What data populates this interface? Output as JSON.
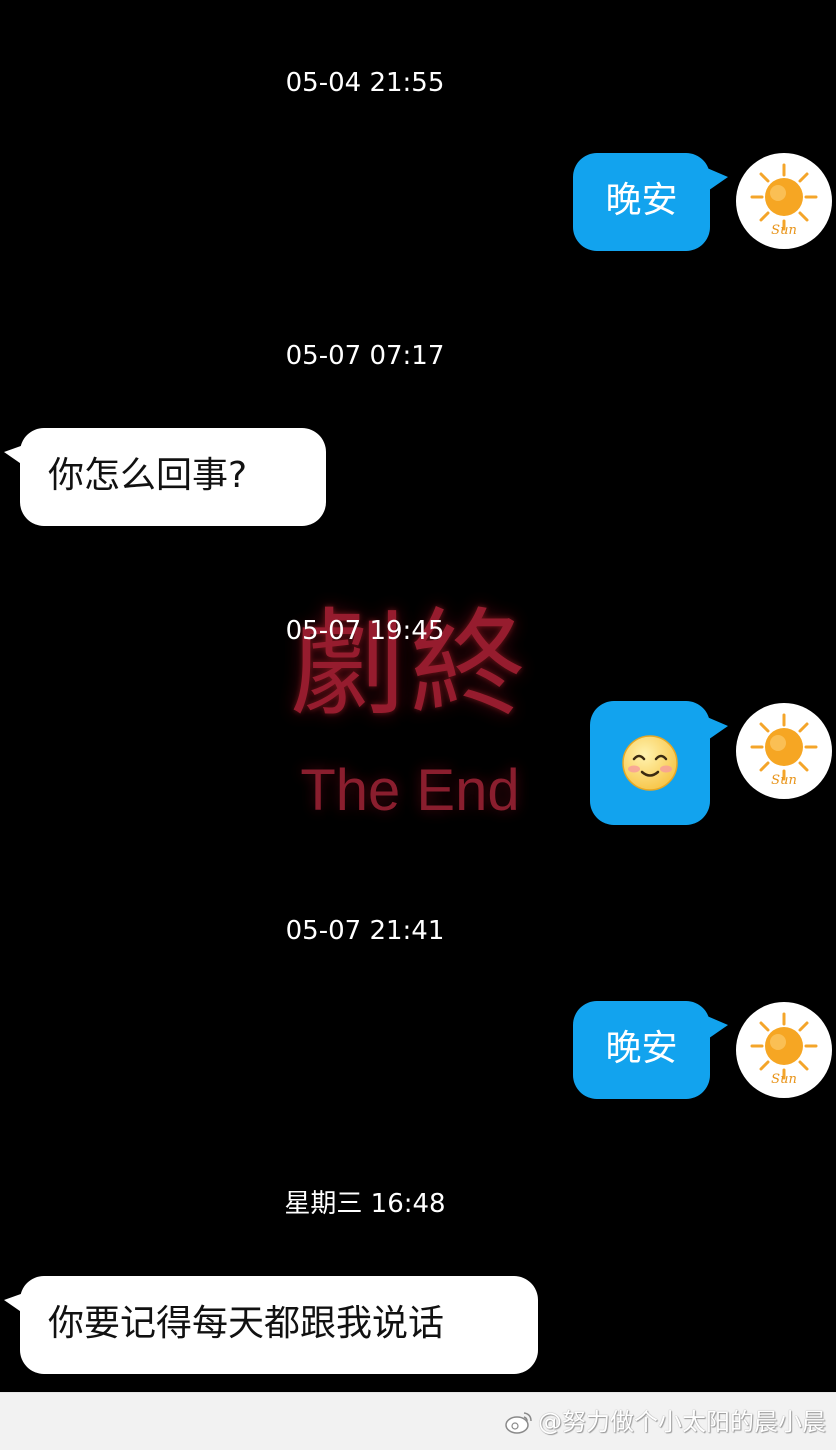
{
  "background": {
    "title": "劇終",
    "subtitle": "The End"
  },
  "messages": [
    {
      "timestamp": "05-04 21:55",
      "side": "out",
      "text": "晚安"
    },
    {
      "timestamp": "05-07 07:17",
      "side": "in",
      "text": "你怎么回事?"
    },
    {
      "timestamp": "05-07 19:45",
      "side": "out",
      "text": "",
      "emoji": "smiling-face"
    },
    {
      "timestamp": "05-07 21:41",
      "side": "out",
      "text": "晚安"
    },
    {
      "timestamp": "星期三 16:48",
      "side": "in",
      "text": "你要记得每天都跟我说话"
    }
  ],
  "avatar": {
    "label": "Sun",
    "icon": "sun-avatar-icon"
  },
  "watermark": {
    "text": "@努力做个小太阳的晨小晨",
    "icon": "weibo-icon"
  },
  "colors": {
    "outgoing_bubble": "#12a3ee",
    "incoming_bubble": "#ffffff",
    "background": "#000000",
    "title_red": "#c0253b"
  }
}
